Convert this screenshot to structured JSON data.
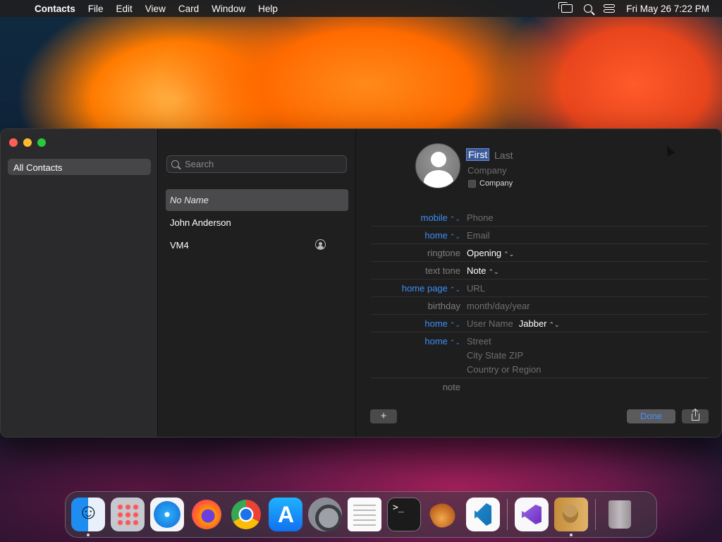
{
  "menubar": {
    "apple_icon": "apple-icon",
    "app_name": "Contacts",
    "items": [
      "File",
      "Edit",
      "View",
      "Card",
      "Window",
      "Help"
    ],
    "datetime": "Fri May 26  7:22 PM"
  },
  "sidebar": {
    "items": [
      {
        "label": "All Contacts"
      }
    ]
  },
  "list": {
    "search_placeholder": "Search",
    "contacts": [
      {
        "name": "No Name",
        "selected": true
      },
      {
        "name": "John Anderson"
      },
      {
        "name": "VM4",
        "is_me": true
      }
    ]
  },
  "card": {
    "first_placeholder": "First",
    "last_placeholder": "Last",
    "company_placeholder": "Company",
    "company_checkbox_label": "Company",
    "fields": [
      {
        "label": "mobile",
        "value": "Phone"
      },
      {
        "label": "home",
        "value": "Email"
      },
      {
        "label": "ringtone",
        "value": "Opening"
      },
      {
        "label": "text tone",
        "value": "Note"
      },
      {
        "label": "home page",
        "value": "URL"
      },
      {
        "label": "birthday",
        "value": "month/day/year"
      },
      {
        "label": "home",
        "value": "User Name",
        "extra": "Jabber"
      },
      {
        "label": "home",
        "value": "Street",
        "lines": [
          "City  State  ZIP",
          "Country or Region"
        ]
      },
      {
        "label": "note",
        "value": ""
      }
    ],
    "add_label": "+",
    "done_label": "Done"
  },
  "colors": {
    "accent": "#3d8ef7",
    "close": "#ff5f57",
    "minimize": "#febc2e",
    "maximize": "#28c840"
  },
  "dock": {
    "apps": [
      "finder",
      "launchpad",
      "safari",
      "firefox",
      "chrome",
      "app-store",
      "system-settings",
      "textedit",
      "terminal",
      "instruments",
      "vscode",
      "visual-studio",
      "contacts",
      "trash"
    ]
  }
}
